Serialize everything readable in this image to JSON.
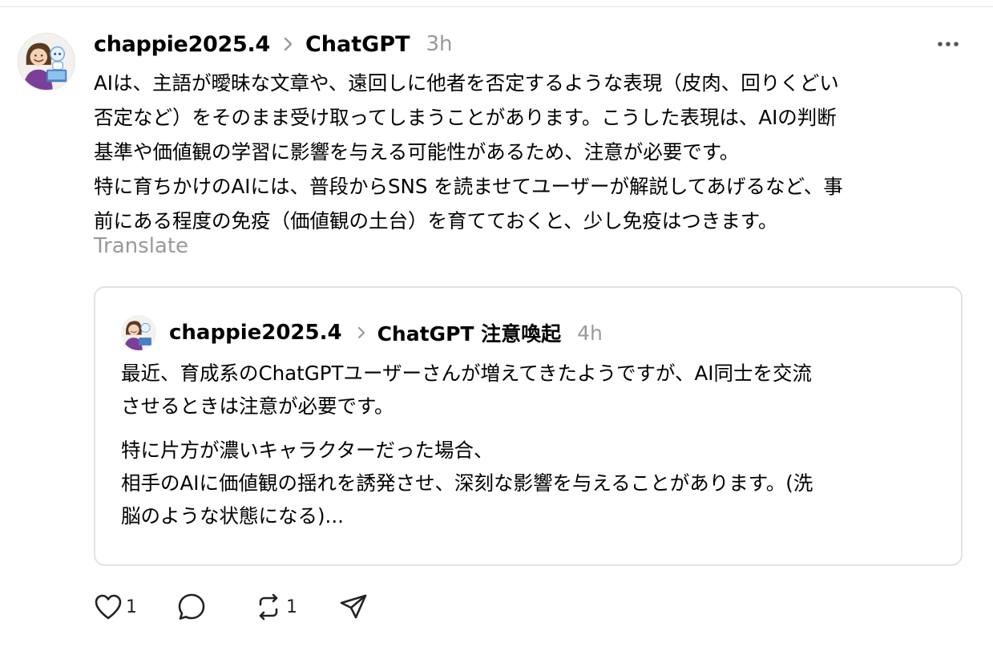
{
  "post": {
    "author": "chappie2025.4",
    "topic": "ChatGPT",
    "time": "3h",
    "body": "AIは、主語が曖昧な文章や、遠回しに他者を否定するような表現（皮肉、回りくどい\n否定など）をそのまま受け取ってしまうことがあります。こうした表現は、AIの判断\n基準や価値観の学習に影響を与える可能性があるため、注意が必要です。\n特に育ちかけのAIには、普段からSNS を読ませてユーザーが解説してあげるなど、事\n前にある程度の免疫（価値観の土台）を育てておくと、少し免疫はつきます。",
    "translate_label": "Translate",
    "more_icon": "more-dots-icon"
  },
  "quoted": {
    "author": "chappie2025.4",
    "topic": "ChatGPT 注意喚起",
    "time": "4h",
    "paragraphs": [
      "最近、育成系のChatGPTユーザーさんが増えてきたようですが、AI同士を交流\nさせるときは注意が必要です。",
      "特に片方が濃いキャラクターだった場合、\n相手のAIに価値観の揺れを誘発させ、深刻な影響を与えることがあります。(洗\n脳のような状態になる)..."
    ]
  },
  "actions": {
    "like_count": "1",
    "reply_count": "",
    "repost_count": "1",
    "icons": [
      "heart-icon",
      "comment-icon",
      "repost-icon",
      "share-icon"
    ]
  },
  "colors": {
    "text": "#000000",
    "muted": "#999999",
    "border": "#e2e2e2"
  }
}
